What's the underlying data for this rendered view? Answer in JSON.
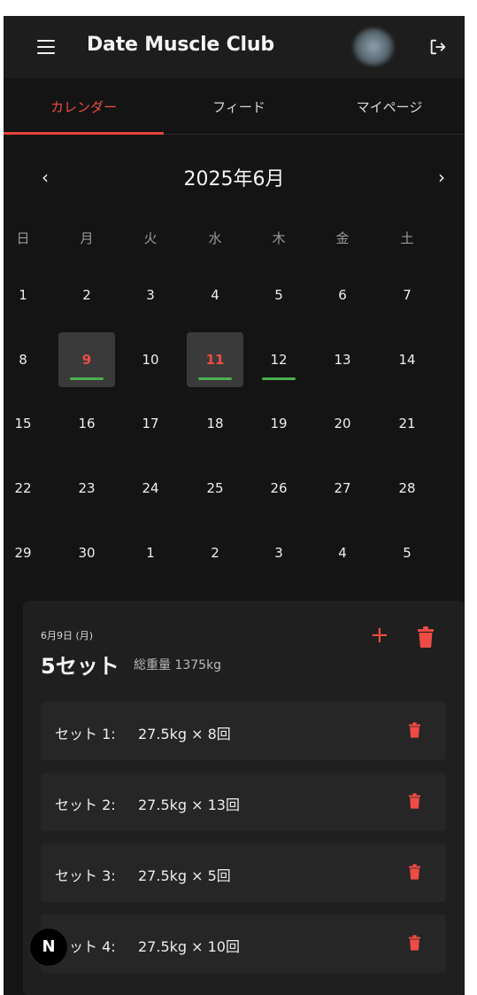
{
  "header": {
    "title": "Date Muscle Club",
    "menu_icon": "hamburger-menu-icon",
    "avatar_icon": "user-avatar",
    "logout_icon": "logout-icon"
  },
  "tabs": [
    {
      "label": "カレンダー",
      "active": true
    },
    {
      "label": "フィード",
      "active": false
    },
    {
      "label": "マイページ",
      "active": false
    }
  ],
  "calendar": {
    "prev": "‹",
    "next": "›",
    "month_title": "2025年6月",
    "weekdays": [
      "日",
      "月",
      "火",
      "水",
      "木",
      "金",
      "土"
    ],
    "weeks": [
      [
        "1",
        "2",
        "3",
        "4",
        "5",
        "6",
        "7"
      ],
      [
        "8",
        "9",
        "10",
        "11",
        "12",
        "13",
        "14"
      ],
      [
        "15",
        "16",
        "17",
        "18",
        "19",
        "20",
        "21"
      ],
      [
        "22",
        "23",
        "24",
        "25",
        "26",
        "27",
        "28"
      ],
      [
        "29",
        "30",
        "1",
        "2",
        "3",
        "4",
        "5"
      ]
    ],
    "selected_days": [
      "9",
      "11"
    ],
    "days_with_workouts": [
      "9",
      "11",
      "12"
    ]
  },
  "detail": {
    "date": "6月9日 (月)",
    "sets_count": "5セット",
    "total_weight": "総重量 1375kg",
    "add_label": "+",
    "sets": [
      {
        "label": "セット 1:",
        "value": "27.5kg × 8回"
      },
      {
        "label": "セット 2:",
        "value": "27.5kg × 13回"
      },
      {
        "label": "セット 3:",
        "value": "27.5kg × 5回"
      },
      {
        "label": "セット 4:",
        "value": "27.5kg × 10回"
      }
    ]
  },
  "badge": "N",
  "colors": {
    "accent": "#ef4b45",
    "workout_bar": "#4caf50",
    "background": "#141414",
    "header": "#1d1d1d"
  }
}
